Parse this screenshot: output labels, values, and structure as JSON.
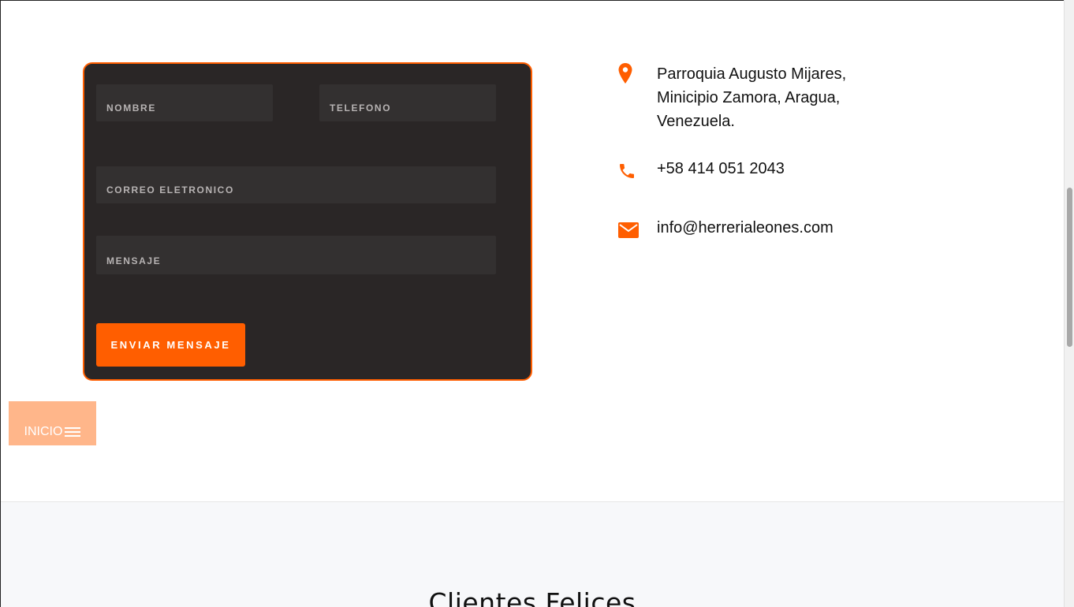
{
  "contact_form": {
    "name_placeholder": "NOMBRE",
    "phone_placeholder": "TELEFONO",
    "email_placeholder": "CORREO ELETRONICO",
    "message_placeholder": "MENSAJE",
    "submit_label": "ENVIAR MENSAJE"
  },
  "contact_info": {
    "address": "Parroquia Augusto Mijares,\nMinicipio Zamora, Aragua,\nVenezuela.",
    "address_icon": "map-pin-icon",
    "phone": "+58 414 051 2043",
    "phone_icon": "phone-icon",
    "email": "info@herrerialeones.com",
    "email_icon": "envelope-icon"
  },
  "floating_menu": {
    "label": "INICIO",
    "icon": "hamburger-icon"
  },
  "section": {
    "title": "Clientes Felices"
  },
  "colors": {
    "accent": "#ff5e00",
    "form_background": "#2a2626",
    "field_background": "#333030",
    "menu_button": "#ffb68a"
  }
}
